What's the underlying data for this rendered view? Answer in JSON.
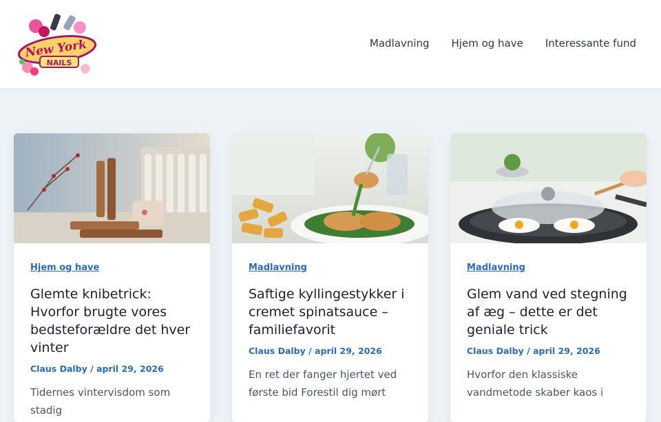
{
  "logo": {
    "line1": "New York",
    "line2": "NAILS"
  },
  "nav": [
    "Madlavning",
    "Hjem og have",
    "Interessante fund"
  ],
  "posts": [
    {
      "category": "Hjem og have",
      "title": "Glemte knibetrick: Hvorfor brugte vores bedsteforældre det hver vinter",
      "author": "Claus Dalby",
      "date": "april 29, 2026",
      "excerpt": "Tidernes vintervisdom som stadig",
      "image_icon": "clothespin-window-photo"
    },
    {
      "category": "Madlavning",
      "title": "Saftige kyllingestykker i cremet spinatsauce – familiefavorit",
      "author": "Claus Dalby",
      "date": "april 29, 2026",
      "excerpt": "En ret der fanger hjertet ved første bid Forestil dig mørt",
      "image_icon": "chicken-spinach-photo"
    },
    {
      "category": "Madlavning",
      "title": "Glem vand ved stegning af æg – dette er det geniale trick",
      "author": "Claus Dalby",
      "date": "april 29, 2026",
      "excerpt": "Hvorfor den klassiske vandmetode skaber kaos i",
      "image_icon": "fried-eggs-pan-photo"
    }
  ]
}
